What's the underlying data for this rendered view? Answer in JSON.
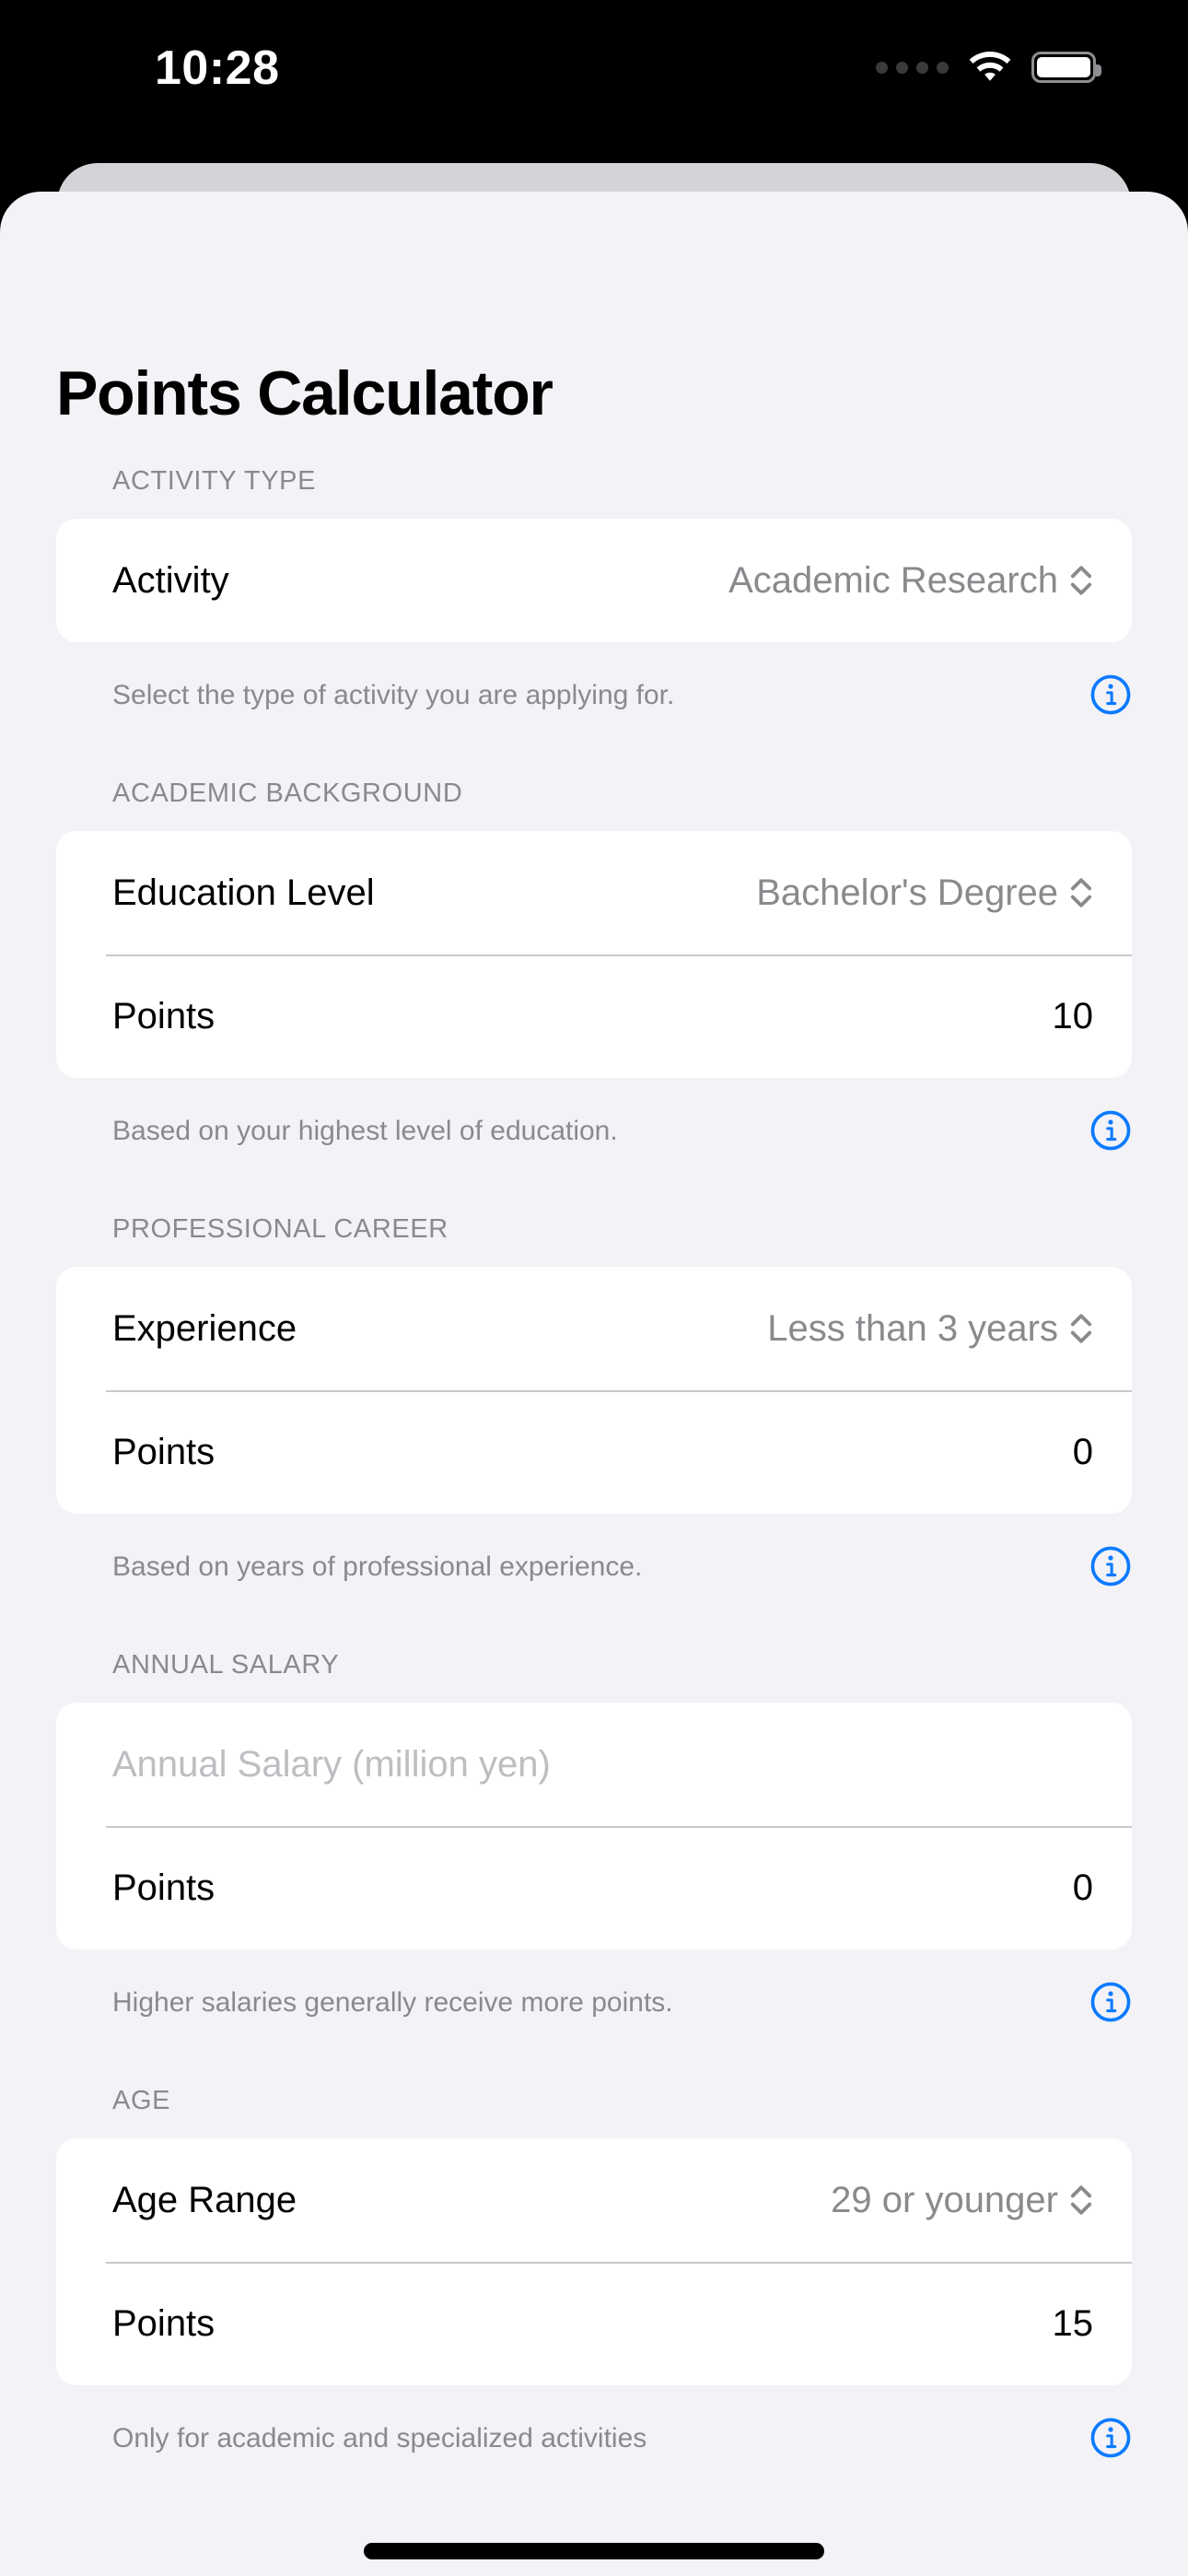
{
  "status_bar": {
    "time": "10:28",
    "signal_icon": "signal-dots-icon",
    "wifi_icon": "wifi-icon",
    "battery_icon": "battery-full-icon"
  },
  "page": {
    "title": "Points Calculator"
  },
  "colors": {
    "accent": "#007AFF",
    "background": "#F2F2F7",
    "card": "#FFFFFF",
    "secondary_text": "#8A8A8E",
    "sheet_behind": "#D3D3D8"
  },
  "sections": [
    {
      "header": "ACTIVITY TYPE",
      "rows": [
        {
          "type": "picker",
          "label": "Activity",
          "value": "Academic Research"
        }
      ],
      "footer": "Select the type of activity you are applying for.",
      "footer_icon": "info-circle-icon"
    },
    {
      "header": "ACADEMIC BACKGROUND",
      "rows": [
        {
          "type": "picker",
          "label": "Education Level",
          "value": "Bachelor's Degree"
        },
        {
          "type": "points",
          "label": "Points",
          "value": "10"
        }
      ],
      "footer": "Based on your highest level of education.",
      "footer_icon": "info-circle-icon"
    },
    {
      "header": "PROFESSIONAL CAREER",
      "rows": [
        {
          "type": "picker",
          "label": "Experience",
          "value": "Less than 3 years"
        },
        {
          "type": "points",
          "label": "Points",
          "value": "0"
        }
      ],
      "footer": "Based on years of professional experience.",
      "footer_icon": "info-circle-icon"
    },
    {
      "header": "ANNUAL SALARY",
      "rows": [
        {
          "type": "input",
          "label": "",
          "value": "",
          "placeholder": "Annual Salary (million yen)"
        },
        {
          "type": "points",
          "label": "Points",
          "value": "0"
        }
      ],
      "footer": "Higher salaries generally receive more points.",
      "footer_icon": "info-circle-icon"
    },
    {
      "header": "AGE",
      "rows": [
        {
          "type": "picker",
          "label": "Age Range",
          "value": "29 or younger"
        },
        {
          "type": "points",
          "label": "Points",
          "value": "15"
        }
      ],
      "footer": "Only for academic and specialized activities",
      "footer_icon": "info-circle-icon"
    }
  ]
}
